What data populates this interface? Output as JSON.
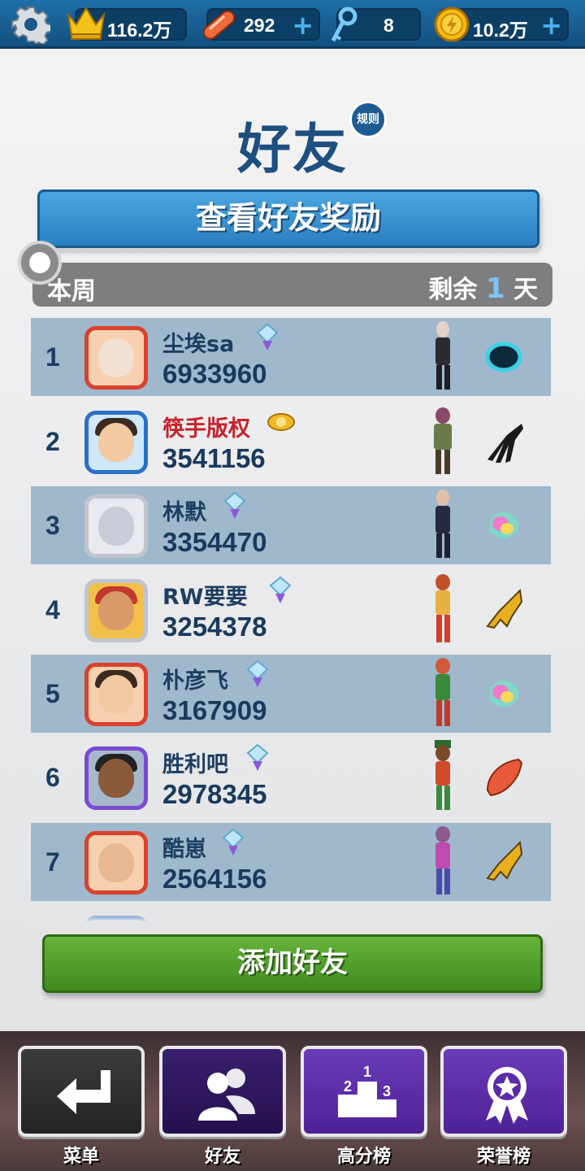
{
  "topbar": {
    "crowns": "116.2万",
    "boards": "292",
    "keys": "8",
    "coins": "10.2万",
    "plus": "+"
  },
  "header": {
    "title": "好友",
    "rules": "规则",
    "reward_button": "查看好友奖励"
  },
  "week": {
    "label": "本周",
    "remaining_prefix": "剩余",
    "remaining_days": "1",
    "remaining_suffix": "天"
  },
  "leaderboard": [
    {
      "rank": "1",
      "name": "尘埃sa",
      "score": "6933960",
      "badge": "diamond-badge-icon",
      "vip": false
    },
    {
      "rank": "2",
      "name": "筷手版权",
      "score": "3541156",
      "badge": "gold-wings-badge-icon",
      "vip": true
    },
    {
      "rank": "3",
      "name": "林默",
      "score": "3354470",
      "badge": "diamond-badge-icon",
      "vip": false
    },
    {
      "rank": "4",
      "name": "RW要要",
      "score": "3254378",
      "badge": "diamond-badge-icon",
      "vip": false
    },
    {
      "rank": "5",
      "name": "朴彦飞",
      "score": "3167909",
      "badge": "diamond-badge-icon",
      "vip": false
    },
    {
      "rank": "6",
      "name": "胜利吧",
      "score": "2978345",
      "badge": "diamond-badge-icon",
      "vip": false
    },
    {
      "rank": "7",
      "name": "酷崽",
      "score": "2564156",
      "badge": "diamond-badge-icon",
      "vip": false
    }
  ],
  "add_friend": "添加好友",
  "nav": {
    "menu": "菜单",
    "friends": "好友",
    "highscores": "高分榜",
    "honor": "荣誉榜"
  },
  "colors": {
    "accent_blue": "#1d4f80",
    "row_alt": "#9fb8cc",
    "vip_red": "#c6232b",
    "green": "#4f9c2a"
  }
}
